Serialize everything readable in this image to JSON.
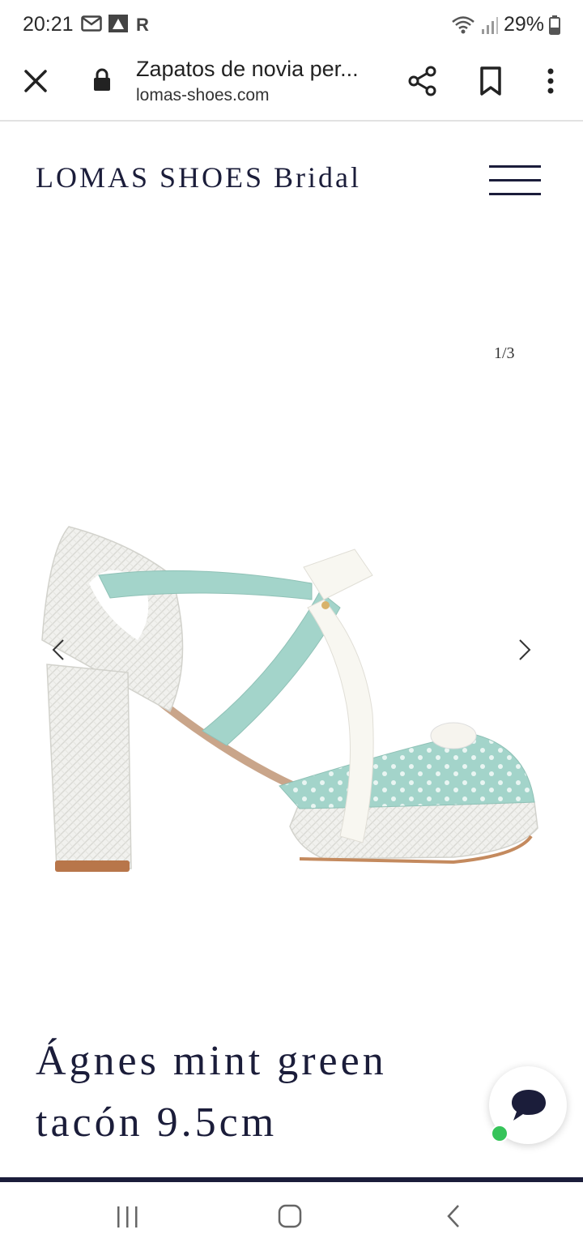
{
  "status_bar": {
    "time": "20:21",
    "battery": "29%",
    "left_icons": [
      "gmail-icon",
      "app-icon",
      "r-app-icon"
    ],
    "right_icons": [
      "wifi-icon",
      "signal-icon",
      "battery-icon"
    ]
  },
  "browser": {
    "page_title": "Zapatos de novia per...",
    "url": "lomas-shoes.com",
    "icons": [
      "close-icon",
      "lock-icon",
      "share-icon",
      "bookmark-icon",
      "more-vert-icon"
    ]
  },
  "site": {
    "brand": "LOMAS SHOES Bridal",
    "menu_icon": "hamburger-icon"
  },
  "gallery": {
    "counter": "1/3",
    "prev_icon": "chevron-left-icon",
    "next_icon": "chevron-right-icon"
  },
  "product": {
    "title_line1": "Ágnes mint green",
    "title_line2": "tacón 9.5cm"
  },
  "chat": {
    "icon": "chat-bubble-icon",
    "status_color": "#36c45a"
  },
  "colors": {
    "brand_navy": "#1b1d3a",
    "mint": "#9fd1c7",
    "white_weave": "#f1f1ee"
  },
  "nav_bar": {
    "icons": [
      "recents-icon",
      "home-icon",
      "back-icon"
    ]
  }
}
